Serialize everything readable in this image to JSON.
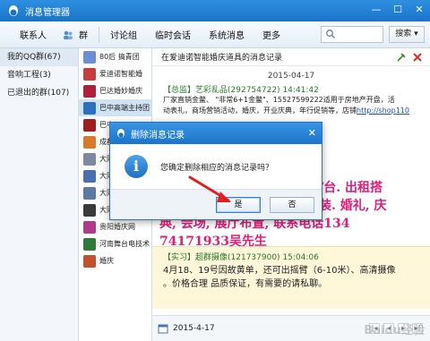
{
  "window": {
    "title": "消息管理器",
    "controls": [
      "minimize",
      "maximize",
      "close"
    ]
  },
  "toolbar": {
    "items": [
      "联系人",
      "群",
      "讨论组",
      "临时会话",
      "系统消息",
      "更多"
    ],
    "search_placeholder": "",
    "search_button": "搜索 ▾"
  },
  "left_panel": {
    "items": [
      "我的QQ群(67)",
      "音响工程(3)",
      "已退出的群(107)"
    ]
  },
  "group_list": {
    "items": [
      {
        "name": "80后 搞青团",
        "color": "#6a8fd6"
      },
      {
        "name": "爱迪诺智能婚",
        "color": "#c83c3c"
      },
      {
        "name": "巴达婚妙婚庆",
        "color": "#b0203a"
      },
      {
        "name": "巴中高端主持团",
        "color": "#2b6fbf"
      },
      {
        "name": "巴中",
        "color": "#a11c1c"
      },
      {
        "name": "成都",
        "color": "#d97a2a"
      },
      {
        "name": "大同",
        "color": "#7c8aa0"
      },
      {
        "name": "大同天镇阳高",
        "color": "#4a6fb0"
      },
      {
        "name": "大同演绎",
        "color": "#5a7aa5"
      },
      {
        "name": "大同赵子明婚",
        "color": "#3a3a3a"
      },
      {
        "name": "贵阳婚庆网",
        "color": "#b23a8a"
      },
      {
        "name": "河南舞台电技术",
        "color": "#2f7a3a"
      },
      {
        "name": "婚庆",
        "color": "#c7502c"
      }
    ],
    "selected_index": 3
  },
  "content": {
    "header": "在爱迪诺智能婚庆道具的消息记录",
    "date": "2015-04-17",
    "msg1": {
      "tag": "【总监】",
      "sender": "艺彩乱品(292754722)",
      "time": "14:41:42",
      "body1": "厂家直销金鳖、 \"非常6+1金鳖\"、15527599222适用于房地产开盘，活",
      "body2": "动表礼，商场营销活动，婚庆，开业庆典，年行促销等，店铺",
      "link": "http://shop110"
    },
    "overlay_lines": [
      "…",
      ".T台. 出租搭",
      "装. 婚礼, 庆",
      "典, 会场, 展厅布置, 联系电话134",
      "74171933吴先生"
    ],
    "msg2": {
      "tag": "【实习】",
      "sender": "超群摄像(121737900)",
      "time": "15:04:06",
      "body1": "4月18、19号因故黄单，还可出摇臂（6-10米）、高清摄像",
      "body2": "。价格合理  品质保证，有需要的请私聊。"
    }
  },
  "status_bar": {
    "date": "2015-4-17"
  },
  "dialog": {
    "title": "删除消息记录",
    "message": "您确定删除相应的消息记录吗？",
    "yes": "是",
    "no": "否",
    "close_glyph": "✕"
  },
  "watermark": "Baidu经验",
  "colors": {
    "accent": "#1d74c9",
    "overlay_text": "#e01e7a",
    "sender_green": "#2a7a2a",
    "annotation_arrow": "#e02020"
  }
}
